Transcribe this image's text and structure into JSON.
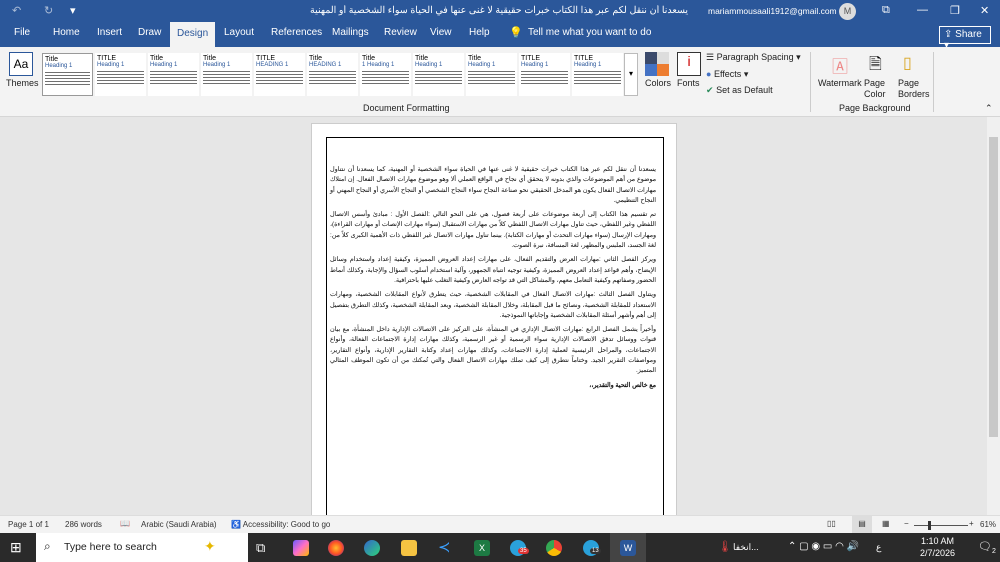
{
  "titlebar": {
    "undo": "↶",
    "redo": "↻",
    "qat": "▾",
    "title": "يسعدنا أن ننقل لكم عبر هذا الكتاب خبرات حقيقية لا غنى عنها في الحياة سواء الشخصية أو المهنية  -  Word",
    "account": "mariammousaali1912@gmail.com",
    "avatar": "M",
    "restore_ribbon": "⧉",
    "minimize": "—",
    "maximize": "❐",
    "close": "✕"
  },
  "tabs": [
    "File",
    "Home",
    "Insert",
    "Draw",
    "Design",
    "Layout",
    "References",
    "Mailings",
    "Review",
    "View",
    "Help"
  ],
  "tell_me": "Tell me what you want to do",
  "share": "Share",
  "ribbon": {
    "themes": "Themes",
    "style_set": [
      {
        "t": "Title",
        "h": "Heading 1"
      },
      {
        "t": "TITLE",
        "h": "Heading 1"
      },
      {
        "t": "Title",
        "h": "Heading 1"
      },
      {
        "t": "Title",
        "h": "Heading 1"
      },
      {
        "t": "TITLE",
        "h": "HEADING 1"
      },
      {
        "t": "Title",
        "h": "HEADING 1"
      },
      {
        "t": "Title",
        "h": "1 Heading 1"
      },
      {
        "t": "Title",
        "h": "Heading 1"
      },
      {
        "t": "Title",
        "h": "Heading 1"
      },
      {
        "t": "TITLE",
        "h": "Heading 1"
      },
      {
        "t": "TITLE",
        "h": "Heading 1"
      }
    ],
    "group_doc_formatting": "Document Formatting",
    "colors": "Colors",
    "fonts": "Fonts",
    "paragraph_spacing": "Paragraph Spacing",
    "effects": "Effects",
    "set_default": "Set as Default",
    "watermark": "Watermark",
    "page_color": "Page Color",
    "page_borders": "Page Borders",
    "group_page_bg": "Page Background"
  },
  "document": {
    "paragraphs": [
      "يسعدنا أن ننقل لكم عبر هذا الكتاب خبرات حقيقية لا غنى عنها في الحياة سواء الشخصية أو المهنية، كما يسعدنا أن نتناول موضوع من أهم الموضوعات والذي بدونه لا يتحقق أي نجاح في الواقع العملي ألا وهو موضوع مهارات الاتصال الفعال. إن امتلاك مهارات الاتصال الفعال يكون هو المدخل الحقيقي نحو صناعة النجاح سواء النجاح الشخصي أو النجاح الأسري أو النجاح المهني أو النجاح التنظيمي.",
      "تم تقسيم هذا الكتاب إلى أربعة موضوعات على أربعة فصول، هي على النحو التالي :الفصل الأول : مبادئ وأسس الاتصال اللفظي وغير اللفظي، حيث تناول مهارات الاتصال اللفظي كلاً من مهارات الاستقبال (سواء مهارات الإنصات أو مهارات القراءة)، ومهارات الإرسال (سواء مهارات التحدث أو مهارات الكتابة). بينما تناول مهارات الاتصال غير اللفظي ذات الأهمية الكبرى كلاً من: لغة الجسد، الملبس والمظهر، لغة المسافة، نبرة الصوت.",
      "ويركز الفصل الثاني :مهارات العرض والتقديم الفعال، على مهارات إعداد العروض المميزة، وكيفية إعداد واستخدام وسائل الإيضاح، وأهم قواعد إعداد العروض المميزة، وكيفية توجيه انتباه الجمهور، وآلية استخدام أسلوب السؤال والإجابة، وكذلك أنماط الحضور وصفاتهم وكيفية التعامل معهم، والمشاكل التي قد تواجه العارض وكيفية التغلب عليها باحترافية.",
      "ويتناول الفصل الثالث :مهارات الاتصال الفعال في المقابلات الشخصية، حيث يتطرق لأنواع المقابلات الشخصية، ومهارات الاستعداد للمقابلة الشخصية، ونصائح ما قبل المقابلة، وخلال المقابلة الشخصية، وبعد المقابلة الشخصية، وكذلك التطرق بتفصيل إلى أهم وأشهر أسئلة المقابلات الشخصية وإجاباتها النموذجية.",
      "وأخيراً يشمل الفصل الرابع :مهارات الاتصال الإداري في المنشأة، على التركيز على الاتصالات الإدارية داخل المنشأة، مع بيان قنوات ووسائل تدفق الاتصالات الإدارية سواء الرسمية أو غير الرسمية، وكذلك مهارات إدارة الاجتماعات الفعالة، وأنواع الاجتماعات، والمراحل الرئيسية لعملية إدارة الاجتماعات، وكذلك مهارات إعداد وكتابة التقارير الإدارية، وأنواع التقارير، ومواصفات التقرير الجيد. وختاماً نتطرق إلى كيف تملك مهارات الاتصال الفعال والتي تُمكنك من أن تكون الموظف المثالي المتميز.",
      "مع خالص التحية والتقدير،،"
    ]
  },
  "status": {
    "page": "Page 1 of 1",
    "words": "286 words",
    "language": "Arabic (Saudi Arabia)",
    "accessibility": "Accessibility: Good to go",
    "zoom": "61%",
    "zoom_percent": 61
  },
  "taskbar": {
    "search_placeholder": "Type here to search",
    "weather": "انخفا...",
    "ime": "ع",
    "time": "1:10 AM",
    "date": "2/7/2026",
    "notif_count": "2",
    "badge_telegram": "35",
    "badge_other": "13"
  }
}
